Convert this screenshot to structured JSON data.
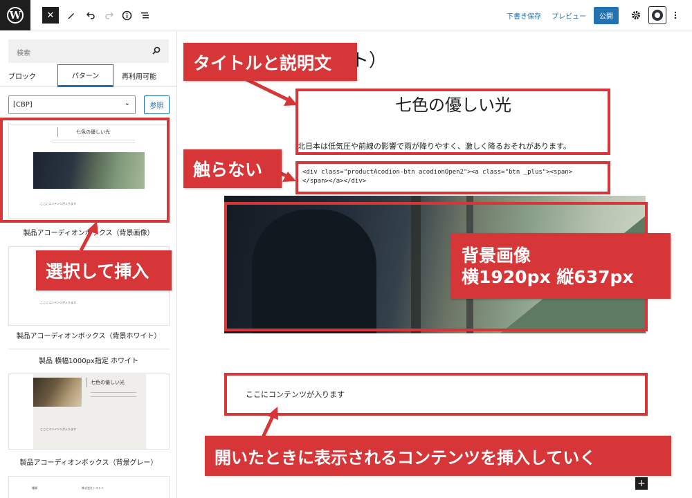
{
  "topbar": {
    "logo": "W",
    "close": "✕",
    "save_draft": "下書き保存",
    "preview": "プレビュー",
    "publish": "公開",
    "icons": [
      "wordpress-logo",
      "close-icon",
      "pencil-icon",
      "undo-icon",
      "redo-icon",
      "info-icon",
      "list-view-icon",
      "gear-icon",
      "plugin-icon",
      "more-icon"
    ]
  },
  "sidebar": {
    "search_placeholder": "検索",
    "tabs": [
      "ブロック",
      "パターン",
      "再利用可能"
    ],
    "active_tab": "パターン",
    "category_select": "[CBP]",
    "ref_button": "参照",
    "patterns": [
      {
        "label": "製品アコーディオンボックス（背景画像）",
        "title": "七色の優しい光",
        "content": "ここにコンテンツが入ります"
      },
      {
        "label": "製品アコーディオンボックス（背景ホワイト）",
        "content": "ここにコンテンツが入ります"
      },
      {
        "label": "製品 横幅1000px指定 ホワイト"
      },
      {
        "label": "製品アコーディオンボックス（背景グレー）",
        "title": "七色の優しい光",
        "content": "ここにコンテンツが入ります"
      }
    ],
    "pattern5_left": "種類",
    "pattern5_right": "株式会社トヨトミ"
  },
  "canvas": {
    "title_fragment": "ト）",
    "heading": "七色の優しい光",
    "description": "北日本は低気圧や前線の影響で雨が降りやすく、激しく降るおそれがあります。",
    "code_line1": "<div class=\"productAcodion-btn acodionOpen2\"><a class=\"btn _plus\"><span>",
    "code_line2": "</span></a></div>",
    "content": "ここにコンテンツが入ります",
    "add_block": "+"
  },
  "annotations": {
    "title_desc": "タイトルと説明文",
    "no_touch": "触らない",
    "select_insert": "選択して挿入",
    "bg_image_line1": "背景画像",
    "bg_image_line2": "横1920px 縦637px",
    "insert_content": "開いたときに表示されるコンテンツを挿入していく"
  },
  "colors": {
    "accent": "#2271b1",
    "annotation": "#d63638",
    "dark": "#1e1e1e"
  }
}
